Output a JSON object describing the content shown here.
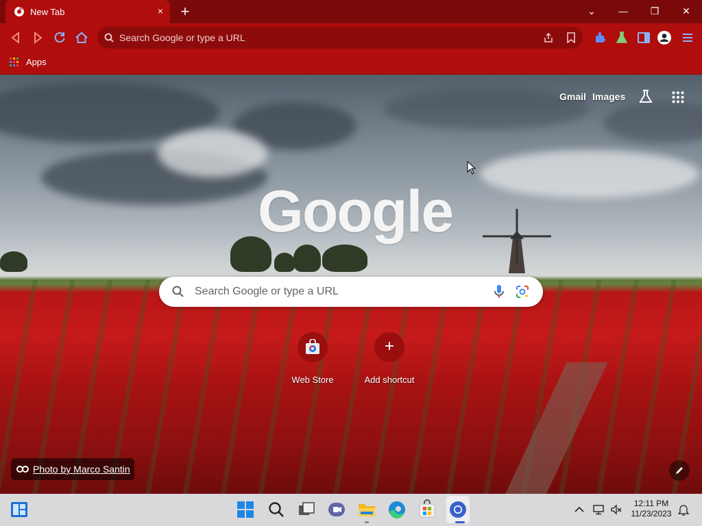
{
  "window": {
    "tab_title": "New Tab",
    "tab_close": "×",
    "new_tab": "+",
    "controls": {
      "dropdown": "⌄",
      "minimize": "—",
      "restore": "❐",
      "close": "✕"
    }
  },
  "toolbar": {
    "omnibox_placeholder": "Search Google or type a URL"
  },
  "bookmarks": {
    "apps_label": "Apps"
  },
  "newtab": {
    "links": {
      "gmail": "Gmail",
      "images": "Images"
    },
    "logo_text": "Google",
    "search_placeholder": "Search Google or type a URL",
    "shortcuts": [
      {
        "label": "Web Store"
      },
      {
        "label": "Add shortcut",
        "symbol": "+"
      }
    ],
    "photo_credit": "Photo by Marco Santin"
  },
  "taskbar": {
    "time": "12:11 PM",
    "date": "11/23/2023"
  },
  "colors": {
    "titlebar": "#7a0a0a",
    "toolbar": "#b00d0d",
    "omnibox": "#8e0b0b",
    "taskbar": "#d9d9db"
  }
}
